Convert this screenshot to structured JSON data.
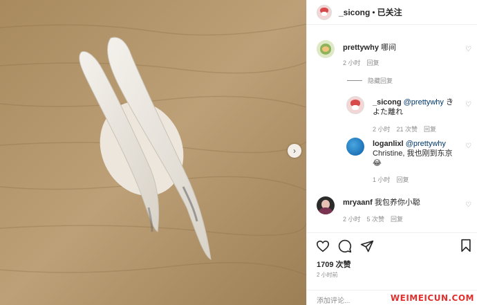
{
  "post": {
    "author": "_sicong",
    "separator": "•",
    "follow_status": "已关注"
  },
  "comments": [
    {
      "username": "prettywhy",
      "text": "哪间",
      "time": "2 小时",
      "reply_label": "回复"
    },
    {
      "username": "_sicong",
      "mention": "@prettywhy",
      "text": "きよた離れ",
      "time": "2 小时",
      "likes": "21 次赞",
      "reply_label": "回复"
    },
    {
      "username": "loganlixl",
      "mention": "@prettywhy",
      "text": "Christine, 我也刚到东京",
      "emoji": "😂",
      "time": "1 小时",
      "reply_label": "回复"
    },
    {
      "username": "mryaanf",
      "text": "我包养你小聪",
      "time": "2 小时",
      "likes": "5 次赞",
      "reply_label": "回复"
    }
  ],
  "hide_replies_label": "隐藏回复",
  "like_count": "1709 次赞",
  "post_time": "2 小时前",
  "add_comment_placeholder": "添加评论...",
  "watermark": "WEIMEICUN.COM",
  "icons": {
    "heart": "heart-icon",
    "comment": "comment-icon",
    "share": "share-icon",
    "bookmark": "bookmark-icon",
    "carousel_next": "chevron-right-icon"
  },
  "colors": {
    "mention": "#00376b",
    "meta": "#8e8e8e",
    "watermark": "#e0312f"
  }
}
